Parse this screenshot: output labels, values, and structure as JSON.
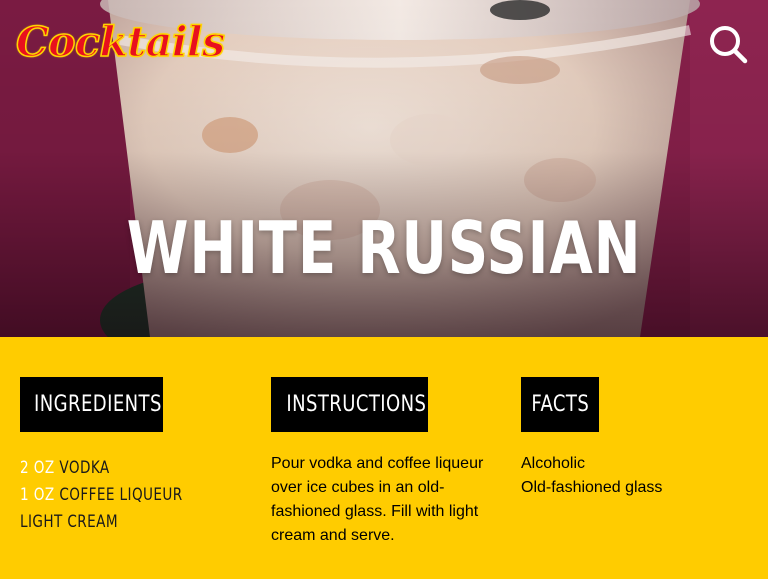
{
  "header": {
    "logo_text": "Cocktails",
    "search_icon": "search-icon"
  },
  "drink": {
    "name": "WHITE RUSSIAN"
  },
  "sections": {
    "ingredients_heading": "INGREDIENTS",
    "instructions_heading": "INSTRUCTIONS",
    "facts_heading": "FACTS"
  },
  "ingredients": [
    {
      "amount": "2 OZ",
      "item": "VODKA"
    },
    {
      "amount": "1 OZ",
      "item": "COFFEE LIQUEUR"
    },
    {
      "amount": "",
      "item": "LIGHT CREAM"
    }
  ],
  "instructions": "Pour vodka and coffee liqueur over ice cubes in an old-fashioned glass. Fill with light cream and serve.",
  "facts": [
    "Alcoholic",
    "Old-fashioned glass"
  ],
  "colors": {
    "accent_yellow": "#ffcc00",
    "logo_red": "#e8101e",
    "heading_bg": "#000000",
    "amount_text": "#ffffff"
  }
}
